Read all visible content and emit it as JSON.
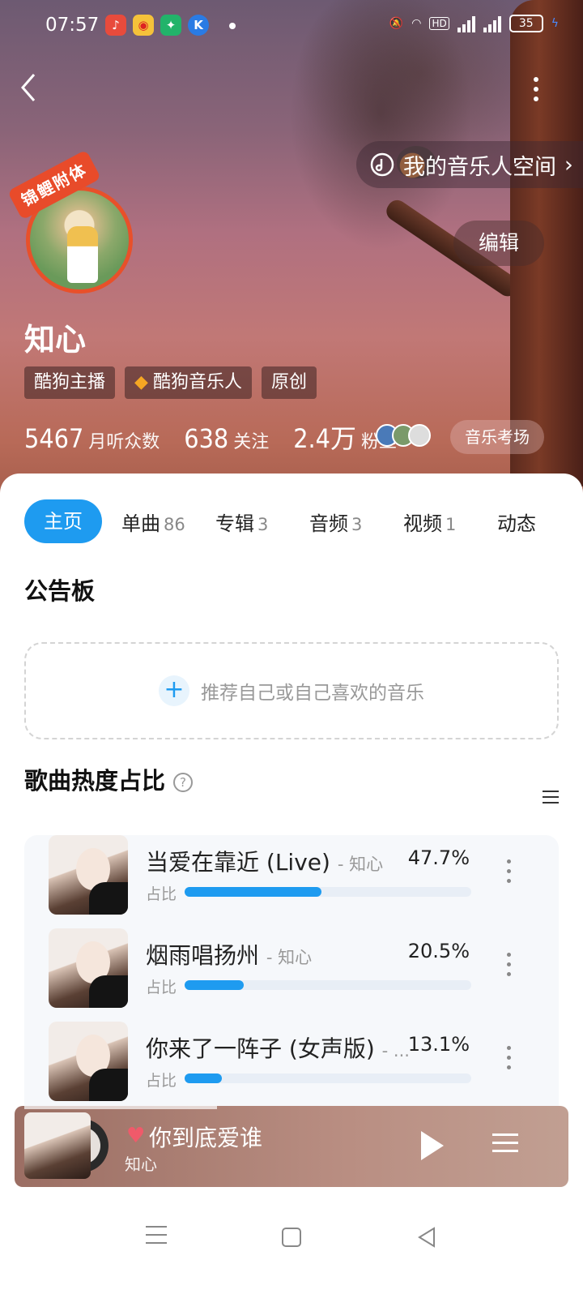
{
  "status_bar": {
    "time": "07:57",
    "battery": "35"
  },
  "header": {
    "music_space_label": "我的音乐人空间",
    "edit_label": "编辑"
  },
  "profile": {
    "badge_text": "锦鲤附体",
    "name": "知心",
    "tags": [
      "酷狗主播",
      "酷狗音乐人",
      "原创"
    ],
    "stats": {
      "monthly_listeners": "5467",
      "monthly_listeners_label": "月听众数",
      "following": "638",
      "following_label": "关注",
      "fans": "2.4万",
      "fans_label": "粉丝"
    },
    "exam_label": "音乐考场"
  },
  "tabs": [
    {
      "label": "主页",
      "count": ""
    },
    {
      "label": "单曲",
      "count": "86"
    },
    {
      "label": "专辑",
      "count": "3"
    },
    {
      "label": "音频",
      "count": "3"
    },
    {
      "label": "视频",
      "count": "1"
    },
    {
      "label": "动态",
      "count": ""
    }
  ],
  "bulletin": {
    "title": "公告板",
    "placeholder": "推荐自己或自己喜欢的音乐"
  },
  "hot_section": {
    "title": "歌曲热度占比",
    "ratio_label": "占比",
    "songs": [
      {
        "title": "当爱在靠近 (Live)",
        "artist": "- 知心",
        "percent": "47.7%",
        "fraction": 0.477
      },
      {
        "title": "烟雨唱扬州",
        "artist": "- 知心",
        "percent": "20.5%",
        "fraction": 0.205
      },
      {
        "title": "你来了一阵子 (女声版)",
        "artist": "- ...",
        "percent": "13.1%",
        "fraction": 0.131
      }
    ]
  },
  "player": {
    "title": "你到底爱谁",
    "artist": "知心"
  },
  "colors": {
    "accent": "#1e9bf0",
    "badge_red": "#e84b2a"
  }
}
